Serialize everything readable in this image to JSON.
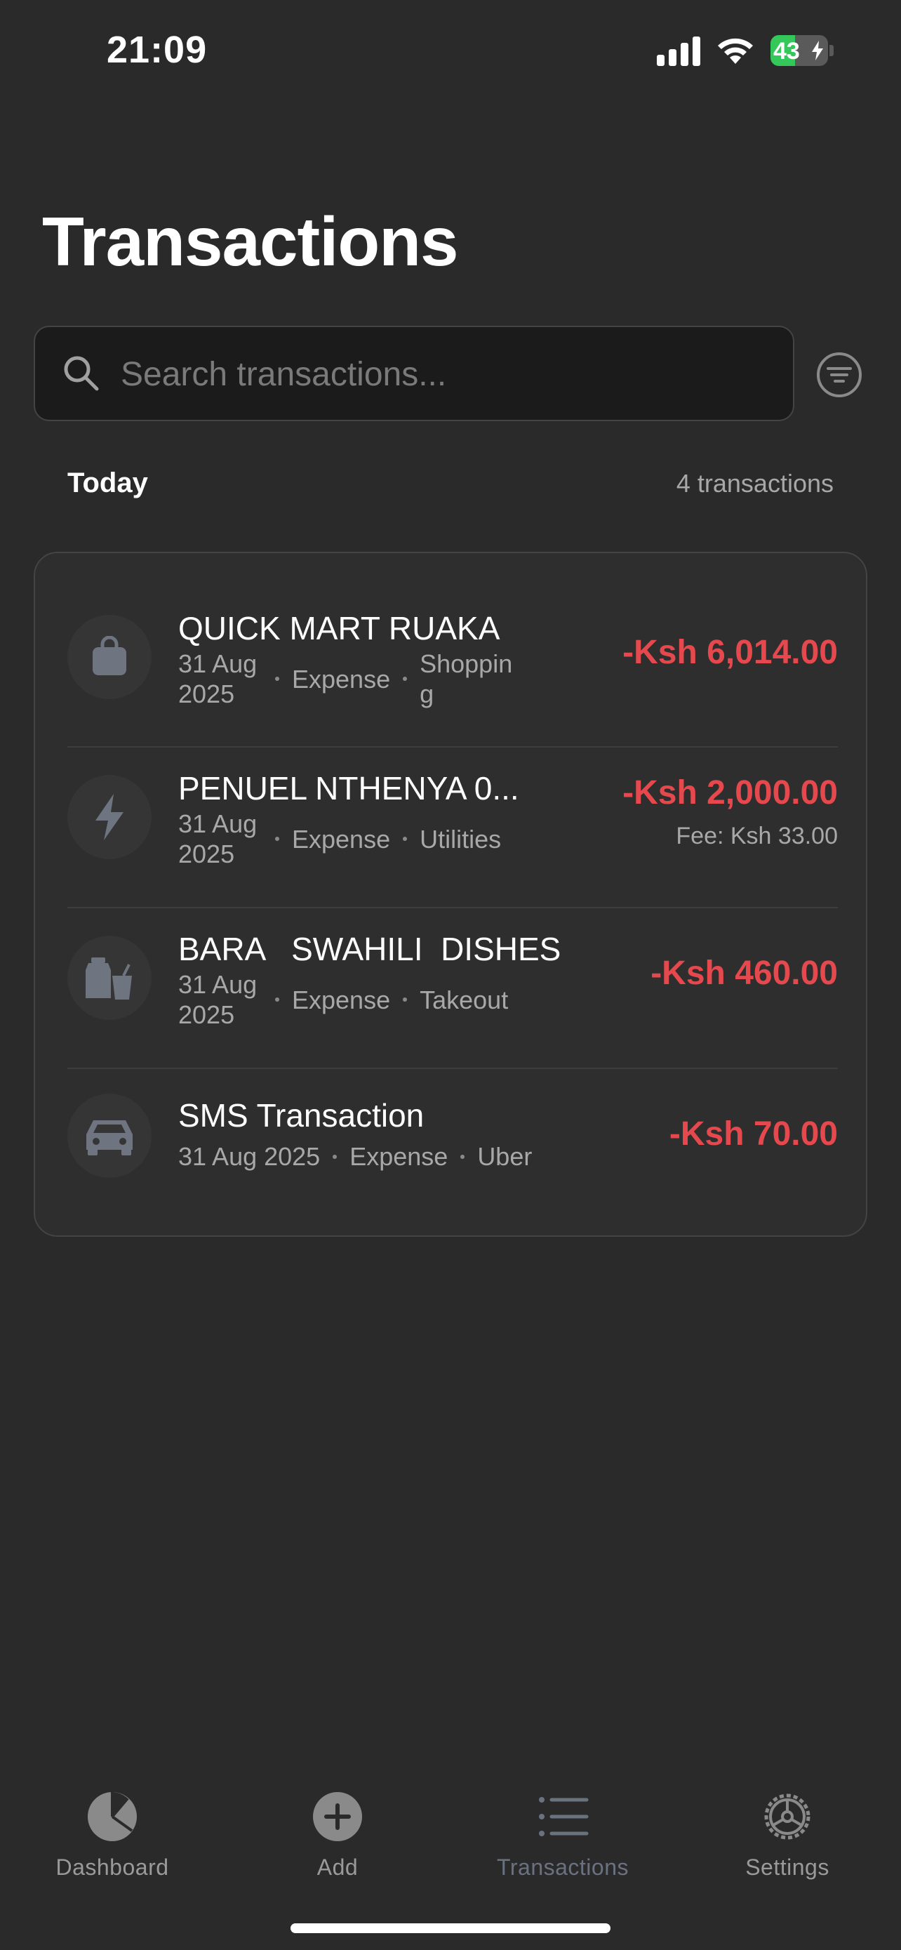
{
  "status_bar": {
    "time": "21:09",
    "battery_level": "43",
    "battery_percent": 43,
    "icons": [
      "signal-icon",
      "wifi-icon",
      "battery-charging-icon"
    ]
  },
  "title": "Transactions",
  "search": {
    "placeholder": "Search transactions...",
    "value": ""
  },
  "filter_icon": "filter-icon",
  "section": {
    "label": "Today",
    "count": "4 transactions"
  },
  "transactions": [
    {
      "name": "QUICK MART RUAKA",
      "date": "31 Aug 2025",
      "type": "Expense",
      "category": "Shopping",
      "amount": "-Ksh 6,014.00",
      "icon": "shopping-bag-icon"
    },
    {
      "name": "PENUEL  NTHENYA 0...",
      "date": "31 Aug 2025",
      "type": "Expense",
      "category": "Utilities",
      "amount": "-Ksh 2,000.00",
      "fee": "Fee: Ksh 33.00",
      "icon": "lightning-icon"
    },
    {
      "name": "BARA   SWAHILI  DISHES",
      "date": "31 Aug 2025",
      "type": "Expense",
      "category": "Takeout",
      "amount": "-Ksh 460.00",
      "icon": "takeout-icon"
    },
    {
      "name": "SMS Transaction",
      "date": "31 Aug 2025",
      "type": "Expense",
      "category": "Uber",
      "amount": "-Ksh 70.00",
      "icon": "car-icon"
    }
  ],
  "tabs": [
    {
      "label": "Dashboard",
      "icon": "pie-chart-icon"
    },
    {
      "label": "Add",
      "icon": "plus-circle-icon"
    },
    {
      "label": "Transactions",
      "icon": "list-icon"
    },
    {
      "label": "Settings",
      "icon": "gear-icon"
    }
  ],
  "colors": {
    "background": "#2a2a2a",
    "card": "#2e2e2e",
    "expense": "#e5484d",
    "muted": "#a8a8a8",
    "battery": "#34c759"
  }
}
